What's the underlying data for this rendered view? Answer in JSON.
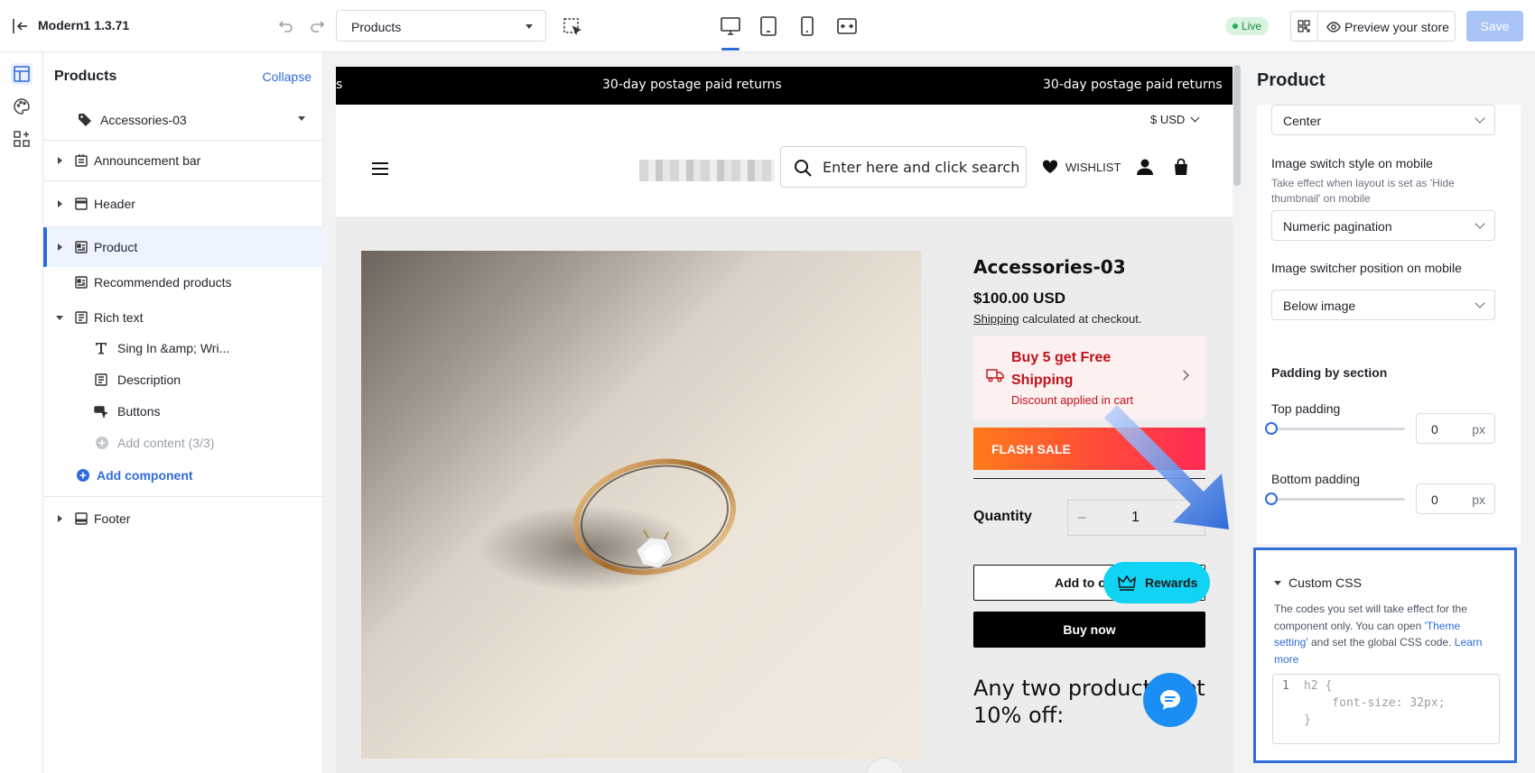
{
  "app": {
    "title": "Modern1 1.3.71",
    "page_select": "Products",
    "live": "Live",
    "preview": "Preview your store",
    "save": "Save"
  },
  "layers": {
    "title": "Products",
    "collapse": "Collapse",
    "items": [
      {
        "label": "Accessories-03"
      },
      {
        "label": "Announcement bar"
      },
      {
        "label": "Header"
      },
      {
        "label": "Product"
      },
      {
        "label": "Recommended products"
      },
      {
        "label": "Rich text"
      },
      {
        "label": "Sing In &amp; Wri..."
      },
      {
        "label": "Description"
      },
      {
        "label": "Buttons"
      },
      {
        "label": "Add content (3/3)"
      },
      {
        "label": "Add component"
      },
      {
        "label": "Footer"
      }
    ]
  },
  "store": {
    "announcement": [
      "s",
      "30-day postage paid returns",
      "30-day postage paid returns"
    ],
    "currency": "$ USD",
    "search_placeholder": "Enter here and click search",
    "wishlist": "WISHLIST",
    "product": {
      "title": "Accessories-03",
      "price": "$100.00 USD",
      "shipping_link": "Shipping",
      "shipping_rest": " calculated at checkout.",
      "promo_title": "Buy 5 get Free Shipping",
      "promo_sub": "Discount applied in cart",
      "flash": "FLASH SALE",
      "quantity_label": "Quantity",
      "quantity_minus": "−",
      "quantity": "1",
      "quantity_plus": "+",
      "add_to_cart": "Add to cart",
      "buy_now": "Buy now",
      "offer": "Any two products get 10% off:"
    },
    "rewards": "Rewards"
  },
  "settings": {
    "title": "Product",
    "alignment_value": "Center",
    "image_switch_label": "Image switch style on mobile",
    "image_switch_hint": "Take effect when layout is set as 'Hide thumbnail' on mobile",
    "image_switch_value": "Numeric pagination",
    "switcher_position_label": "Image switcher position on mobile",
    "switcher_position_value": "Below image",
    "padding_title": "Padding by section",
    "top_padding_label": "Top padding",
    "top_padding_value": "0",
    "bottom_padding_label": "Bottom padding",
    "bottom_padding_value": "0",
    "unit": "px",
    "custom_css": {
      "title": "Custom CSS",
      "desc_1": "The codes you set will take effect for the component only. You can open ",
      "desc_link_1": "'Theme setting'",
      "desc_2": " and set the global CSS code. ",
      "desc_link_2": "Learn more",
      "line_number": "1",
      "code_line_1": "h2 {",
      "code_line_2": "    font-size: 32px;",
      "code_line_3": "}"
    }
  },
  "colors": {
    "accent": "#2f6bd9",
    "promo_red": "#c0121a",
    "rewards": "#11d3f3",
    "chat": "#1a8ef5",
    "live_green": "#1f8a46"
  }
}
